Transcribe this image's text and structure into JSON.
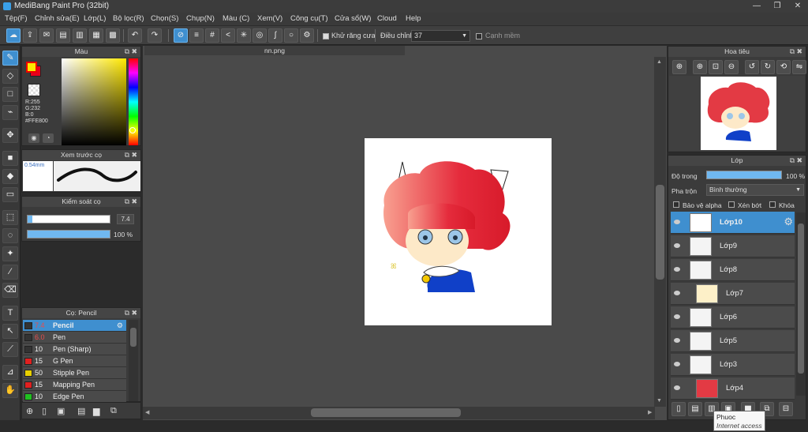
{
  "app": {
    "title": "MediBang Paint Pro (32bit)"
  },
  "window_buttons": {
    "minimize": "—",
    "maximize": "❐",
    "close": "✕"
  },
  "menu": [
    "Tệp(F)",
    "Chỉnh sửa(E)",
    "Lớp(L)",
    "Bộ lọc(R)",
    "Chọn(S)",
    "Chụp(N)",
    "Màu (C)",
    "Xem(V)",
    "Công cụ(T)",
    "Cửa sổ(W)",
    "Cloud",
    "Help"
  ],
  "toolbar": {
    "antialias_label": "Khử răng cưa",
    "adjust_label": "Điều chỉnh",
    "adjust_value": "37",
    "edge_label": "Cạnh mềm"
  },
  "color_panel": {
    "title": "Màu",
    "r": "R:255",
    "g": "G:232",
    "b": "B:0",
    "hex": "#FFE800",
    "fg_color": "#ffe800",
    "bg_color": "#e8001c"
  },
  "brush_preview": {
    "title": "Xem trước cọ",
    "size": "0.54mm"
  },
  "brush_control": {
    "title": "Kiểm soát cọ",
    "size_value": "7.4",
    "size_fill": 0.06,
    "opacity_value": "100 %",
    "opacity_fill": 1.0
  },
  "brush_list": {
    "title": "Cọ: Pencil",
    "items": [
      {
        "size": "7.4",
        "name": "Pencil",
        "color": "#333333",
        "selected": true
      },
      {
        "size": "6.0",
        "name": "Pen",
        "color": "#333333",
        "selected": false
      },
      {
        "size": "10",
        "name": "Pen (Sharp)",
        "color": "#333333",
        "selected": false
      },
      {
        "size": "15",
        "name": "G Pen",
        "color": "#e02020",
        "selected": false
      },
      {
        "size": "50",
        "name": "Stipple Pen",
        "color": "#e8d000",
        "selected": false
      },
      {
        "size": "15",
        "name": "Mapping Pen",
        "color": "#e02020",
        "selected": false
      },
      {
        "size": "10",
        "name": "Edge Pen",
        "color": "#20c020",
        "selected": false
      }
    ]
  },
  "canvas": {
    "tab_title": "nn.png"
  },
  "navigator": {
    "title": "Hoa tiêu"
  },
  "layers_panel": {
    "title": "Lớp",
    "opacity_label": "Độ trong",
    "opacity_value": "100 %",
    "opacity_fill": 1.0,
    "blend_label": "Pha trộn",
    "blend_value": "Bình thường",
    "protect_alpha": "Bảo vệ alpha",
    "clipping": "Xén bớt",
    "lock": "Khóa",
    "layers": [
      {
        "name": "Lớp10",
        "selected": true
      },
      {
        "name": "Lớp9",
        "selected": false
      },
      {
        "name": "Lớp8",
        "selected": false
      },
      {
        "name": "Lớp7",
        "selected": false
      },
      {
        "name": "Lớp6",
        "selected": false
      },
      {
        "name": "Lớp5",
        "selected": false
      },
      {
        "name": "Lớp3",
        "selected": false
      },
      {
        "name": "Lớp4",
        "selected": false
      }
    ]
  },
  "tooltip": {
    "line1": "Phuoc",
    "line2": "Internet access"
  }
}
